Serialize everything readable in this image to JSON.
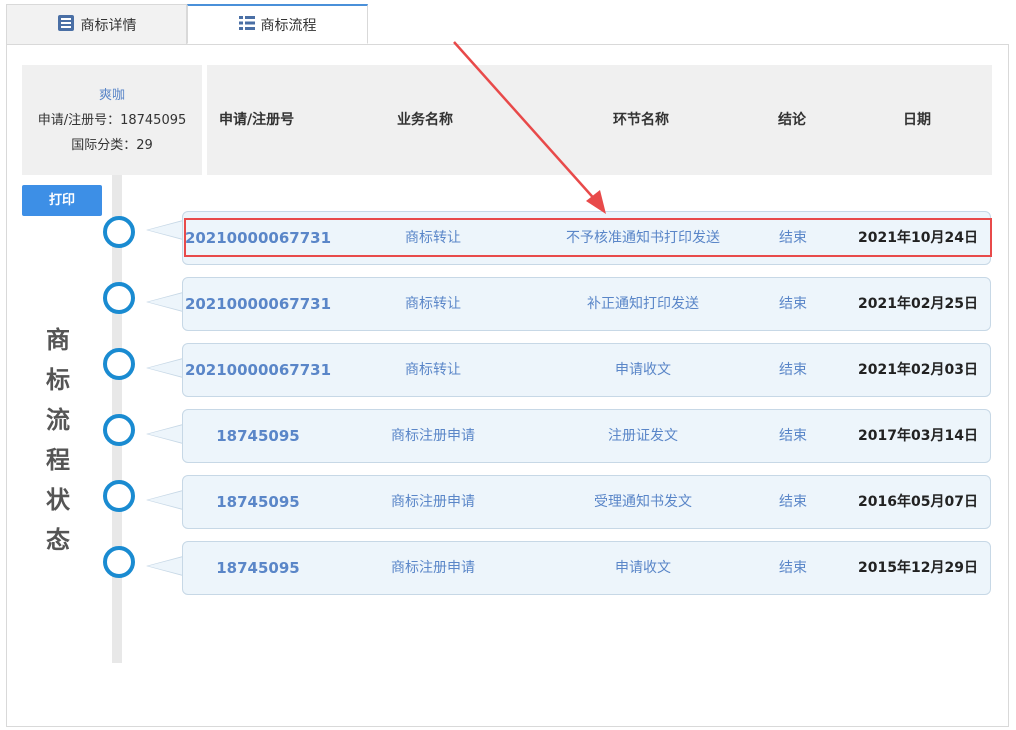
{
  "tabs": [
    {
      "label": "商标详情",
      "icon": "document-list-icon"
    },
    {
      "label": "商标流程",
      "icon": "table-list-icon"
    }
  ],
  "info": {
    "name": "爽咖",
    "reg_line": "申请/注册号：18745095",
    "class_line": "国际分类：29"
  },
  "table": {
    "headers": [
      "申请/注册号",
      "业务名称",
      "环节名称",
      "结论",
      "日期"
    ]
  },
  "print_label": "打印",
  "side_title": [
    "商",
    "标",
    "流",
    "程",
    "状",
    "态"
  ],
  "rows": [
    {
      "reg": "20210000067731",
      "biz": "商标转让",
      "step": "不予核准通知书打印发送",
      "result": "结束",
      "date": "2021年10月24日"
    },
    {
      "reg": "20210000067731",
      "biz": "商标转让",
      "step": "补正通知打印发送",
      "result": "结束",
      "date": "2021年02月25日"
    },
    {
      "reg": "20210000067731",
      "biz": "商标转让",
      "step": "申请收文",
      "result": "结束",
      "date": "2021年02月03日"
    },
    {
      "reg": "18745095",
      "biz": "商标注册申请",
      "step": "注册证发文",
      "result": "结束",
      "date": "2017年03月14日"
    },
    {
      "reg": "18745095",
      "biz": "商标注册申请",
      "step": "受理通知书发文",
      "result": "结束",
      "date": "2016年05月07日"
    },
    {
      "reg": "18745095",
      "biz": "商标注册申请",
      "step": "申请收文",
      "result": "结束",
      "date": "2015年12月29日"
    }
  ],
  "colors": {
    "accent": "#1a8bd1",
    "highlight": "#e84a4a",
    "link": "#5a86c8"
  }
}
